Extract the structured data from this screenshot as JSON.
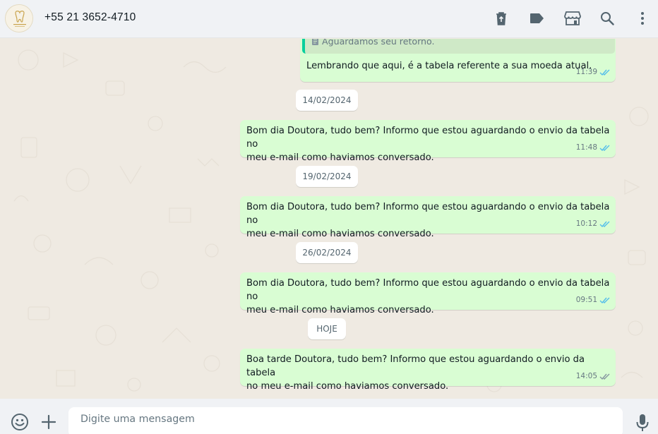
{
  "header": {
    "contact_name": "+55 21 3652-4710",
    "icons": [
      "trash-icon",
      "label-tag-icon",
      "store-icon",
      "search-icon",
      "menu-icon"
    ]
  },
  "messages": [
    {
      "quote": "Aguardamos seu retorno.",
      "text": "Lembrando que aqui, é a tabela referente a sua moeda atual.",
      "time": "11:39",
      "status": "read"
    },
    {
      "date": "14/02/2024"
    },
    {
      "text_line1": "Bom dia Doutora, tudo bem? Informo que estou aguardando o envio da tabela no",
      "text_line2": "meu e-mail como haviamos conversado.",
      "time": "11:48",
      "status": "read"
    },
    {
      "date": "19/02/2024"
    },
    {
      "text_line1": "Bom dia Doutora, tudo bem? Informo que estou aguardando o envio da tabela no",
      "text_line2": "meu e-mail como haviamos conversado.",
      "time": "10:12",
      "status": "read"
    },
    {
      "date": "26/02/2024"
    },
    {
      "text_line1": "Bom dia Doutora, tudo bem? Informo que estou aguardando o envio da tabela no",
      "text_line2": "meu e-mail como haviamos conversado.",
      "time": "09:51",
      "status": "read"
    },
    {
      "date": "HOJE"
    },
    {
      "text_line1": "Boa tarde Doutora, tudo bem? Informo que estou aguardando o envio da tabela",
      "text_line2": "no meu e-mail como haviamos conversado.",
      "time": "14:05",
      "status": "delivered"
    }
  ],
  "composer": {
    "placeholder": "Digite uma mensagem"
  },
  "colors": {
    "outgoing_bubble": "#d9fdd3",
    "chat_background": "#efeae2",
    "read_ticks": "#53bdeb",
    "delivered_ticks": "#8696a0",
    "header_background": "#f0f2f5"
  }
}
